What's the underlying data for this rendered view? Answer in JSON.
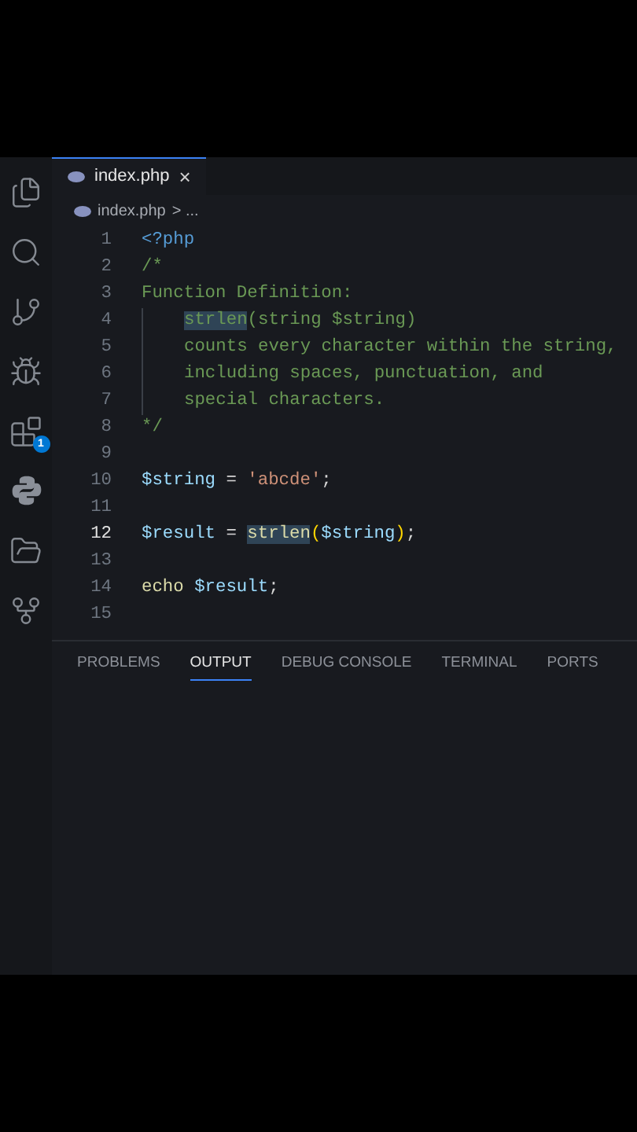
{
  "activity_bar": {
    "items": [
      {
        "kind": "files"
      },
      {
        "kind": "search"
      },
      {
        "kind": "source-control"
      },
      {
        "kind": "run-debug"
      },
      {
        "kind": "extensions",
        "badge": "1"
      },
      {
        "kind": "python"
      },
      {
        "kind": "folder"
      },
      {
        "kind": "git-graph"
      }
    ]
  },
  "tabs": [
    {
      "label": "index.php",
      "selected": true,
      "close": "×"
    }
  ],
  "breadcrumb": {
    "file": "index.php",
    "rest": "> ..."
  },
  "editor": {
    "lines": [
      {
        "number": "1",
        "current": false,
        "indented": false,
        "tokens": [
          {
            "kind": "keyword",
            "text": "<?php"
          }
        ]
      },
      {
        "number": "2",
        "current": false,
        "indented": false,
        "tokens": [
          {
            "kind": "comment",
            "text": "/*"
          }
        ]
      },
      {
        "number": "3",
        "current": false,
        "indented": false,
        "tokens": [
          {
            "kind": "comment",
            "text": "Function Definition:"
          }
        ]
      },
      {
        "number": "4",
        "current": false,
        "indented": true,
        "tokens": [
          {
            "kind": "comment-match",
            "text": "strlen"
          },
          {
            "kind": "comment",
            "text": "(string $string)"
          }
        ]
      },
      {
        "number": "5",
        "current": false,
        "indented": true,
        "tokens": [
          {
            "kind": "comment",
            "text": "counts every character within the string,"
          }
        ]
      },
      {
        "number": "6",
        "current": false,
        "indented": true,
        "tokens": [
          {
            "kind": "comment",
            "text": "including spaces, punctuation, and"
          }
        ]
      },
      {
        "number": "7",
        "current": false,
        "indented": true,
        "tokens": [
          {
            "kind": "comment",
            "text": "special characters."
          }
        ]
      },
      {
        "number": "8",
        "current": false,
        "indented": false,
        "tokens": [
          {
            "kind": "comment",
            "text": "*/"
          }
        ]
      },
      {
        "number": "9",
        "current": false,
        "indented": false
      },
      {
        "number": "10",
        "current": false,
        "indented": false,
        "tokens": [
          {
            "kind": "variable",
            "text": "$string"
          },
          {
            "kind": "plain",
            "text": " = "
          },
          {
            "kind": "string",
            "text": "'abcde'"
          },
          {
            "kind": "plain",
            "text": ";"
          }
        ]
      },
      {
        "number": "11",
        "current": false,
        "indented": false
      },
      {
        "number": "12",
        "current": true,
        "indented": false,
        "tokens": [
          {
            "kind": "variable",
            "text": "$result"
          },
          {
            "kind": "plain",
            "text": " = "
          },
          {
            "kind": "function-match",
            "text": "strlen"
          },
          {
            "kind": "paren",
            "text": "("
          },
          {
            "kind": "variable",
            "text": "$string"
          },
          {
            "kind": "paren",
            "text": ")"
          },
          {
            "kind": "plain",
            "text": ";"
          }
        ]
      },
      {
        "number": "13",
        "current": false,
        "indented": false
      },
      {
        "number": "14",
        "current": false,
        "indented": false,
        "tokens": [
          {
            "kind": "function",
            "text": "echo"
          },
          {
            "kind": "variable",
            "text": " $result"
          },
          {
            "kind": "plain",
            "text": ";"
          }
        ]
      },
      {
        "number": "15",
        "current": false,
        "indented": false
      }
    ]
  },
  "panel": {
    "tabs": [
      {
        "label": "PROBLEMS",
        "selected": false
      },
      {
        "label": "OUTPUT",
        "selected": true
      },
      {
        "label": "DEBUG CONSOLE",
        "selected": false
      },
      {
        "label": "TERMINAL",
        "selected": false
      },
      {
        "label": "PORTS",
        "selected": false
      }
    ]
  }
}
